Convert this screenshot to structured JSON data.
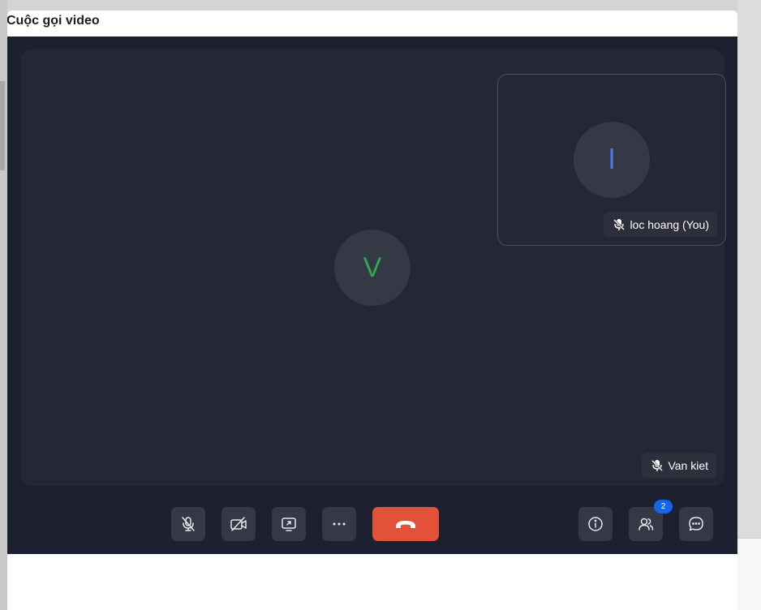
{
  "window": {
    "title": "Cuộc gọi video"
  },
  "main_participant": {
    "initial": "V",
    "name": "Van kiet"
  },
  "self_participant": {
    "initial": "l",
    "name": "loc hoang (You)"
  },
  "participants_count": "2",
  "colors": {
    "call_background": "#1c2030",
    "stage_background": "#242736",
    "hangup": "#e2513a",
    "badge": "#1565e8",
    "avatar_main_letter": "#2fa84f",
    "avatar_self_letter": "#4c7cf0"
  },
  "toolbar": {
    "left_icons": [
      "mic-off-icon",
      "camera-off-icon",
      "screen-share-icon",
      "more-icon"
    ],
    "center_icon": "hang-up-icon",
    "right_icons": [
      "info-icon",
      "participants-icon",
      "chat-icon"
    ]
  }
}
